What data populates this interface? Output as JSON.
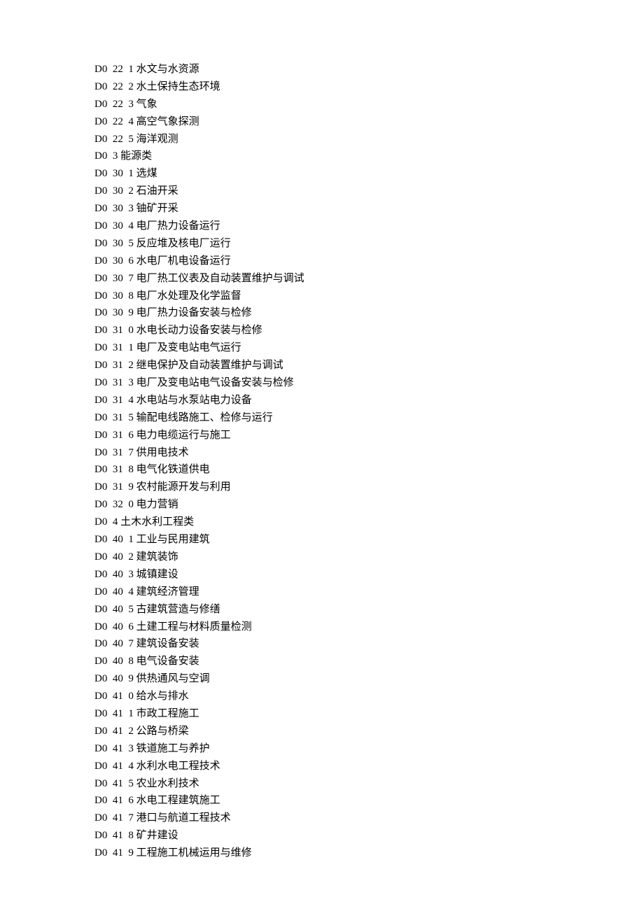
{
  "entries": [
    {
      "code": "D0  22  1",
      "name": "水文与水资源"
    },
    {
      "code": "D0  22  2",
      "name": "水土保持生态环境"
    },
    {
      "code": "D0  22  3",
      "name": "气象"
    },
    {
      "code": "D0  22  4",
      "name": "高空气象探测"
    },
    {
      "code": "D0  22  5",
      "name": "海洋观测"
    },
    {
      "code": "D0  3",
      "name": "能源类"
    },
    {
      "code": "D0  30  1",
      "name": "选煤"
    },
    {
      "code": "D0  30  2",
      "name": "石油开采"
    },
    {
      "code": "D0  30  3",
      "name": "铀矿开采"
    },
    {
      "code": "D0  30  4",
      "name": "电厂热力设备运行"
    },
    {
      "code": "D0  30  5",
      "name": "反应堆及核电厂运行"
    },
    {
      "code": "D0  30  6",
      "name": "水电厂机电设备运行"
    },
    {
      "code": "D0  30  7",
      "name": "电厂热工仪表及自动装置维护与调试"
    },
    {
      "code": "D0  30  8",
      "name": "电厂水处理及化学监督"
    },
    {
      "code": "D0  30  9",
      "name": "电厂热力设备安装与检修"
    },
    {
      "code": "D0  31  0",
      "name": "水电长动力设备安装与检修"
    },
    {
      "code": "D0  31  1",
      "name": "电厂及变电站电气运行"
    },
    {
      "code": "D0  31  2",
      "name": "继电保护及自动装置维护与调试"
    },
    {
      "code": "D0  31  3",
      "name": "电厂及变电站电气设备安装与检修"
    },
    {
      "code": "D0  31  4",
      "name": "水电站与水泵站电力设备"
    },
    {
      "code": "D0  31  5",
      "name": "输配电线路施工、检修与运行"
    },
    {
      "code": "D0  31  6",
      "name": "电力电缆运行与施工"
    },
    {
      "code": "D0  31  7",
      "name": "供用电技术"
    },
    {
      "code": "D0  31  8",
      "name": "电气化铁道供电"
    },
    {
      "code": "D0  31  9",
      "name": "农村能源开发与利用"
    },
    {
      "code": "D0  32  0",
      "name": "电力营销"
    },
    {
      "code": "D0  4",
      "name": "土木水利工程类"
    },
    {
      "code": "D0  40  1",
      "name": "工业与民用建筑"
    },
    {
      "code": "D0  40  2",
      "name": "建筑装饰"
    },
    {
      "code": "D0  40  3",
      "name": "城镇建设"
    },
    {
      "code": "D0  40  4",
      "name": "建筑经济管理"
    },
    {
      "code": "D0  40  5",
      "name": "古建筑营造与修缮"
    },
    {
      "code": "D0  40  6",
      "name": "土建工程与材料质量检测"
    },
    {
      "code": "D0  40  7",
      "name": "建筑设备安装"
    },
    {
      "code": "D0  40  8",
      "name": "电气设备安装"
    },
    {
      "code": "D0  40  9",
      "name": "供热通风与空调"
    },
    {
      "code": "D0  41  0",
      "name": "给水与排水"
    },
    {
      "code": "D0  41  1",
      "name": "市政工程施工"
    },
    {
      "code": "D0  41  2",
      "name": "公路与桥梁"
    },
    {
      "code": "D0  41  3",
      "name": "铁道施工与养护"
    },
    {
      "code": "D0  41  4",
      "name": "水利水电工程技术"
    },
    {
      "code": "D0  41  5",
      "name": "农业水利技术"
    },
    {
      "code": "D0  41  6",
      "name": "水电工程建筑施工"
    },
    {
      "code": "D0  41  7",
      "name": "港口与航道工程技术"
    },
    {
      "code": "D0  41  8",
      "name": "矿井建设"
    },
    {
      "code": "D0  41  9",
      "name": "工程施工机械运用与维修"
    }
  ]
}
